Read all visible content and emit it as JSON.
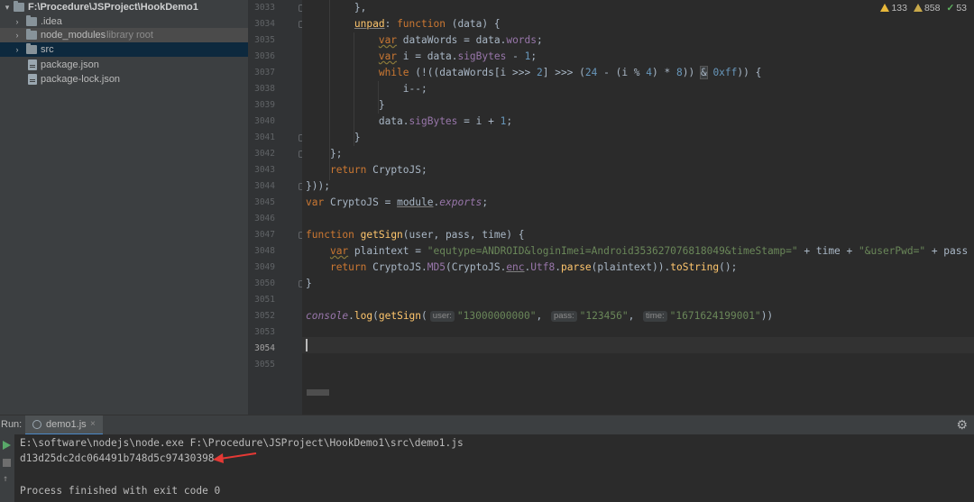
{
  "project_tree": {
    "root": "F:\\Procedure\\JSProject\\HookDemo1",
    "items": [
      {
        "label": "F:\\Procedure\\JSProject\\HookDemo1",
        "type": "folder",
        "expanded": true,
        "depth": 0
      },
      {
        "label": ".idea",
        "type": "folder",
        "expanded": false,
        "depth": 1
      },
      {
        "label": "node_modules",
        "sub": "library root",
        "type": "folder",
        "expanded": false,
        "depth": 1
      },
      {
        "label": "src",
        "type": "folder",
        "expanded": false,
        "depth": 1,
        "selected": true
      },
      {
        "label": "package.json",
        "type": "file",
        "depth": 1
      },
      {
        "label": "package-lock.json",
        "type": "file",
        "depth": 1
      }
    ]
  },
  "inspections": {
    "warnings": "133",
    "weak_warnings": "858",
    "ok": "53"
  },
  "editor": {
    "line_numbers": [
      "3033",
      "3034",
      "3035",
      "3036",
      "3037",
      "3038",
      "3039",
      "3040",
      "3041",
      "3042",
      "3043",
      "3044",
      "3045",
      "3046",
      "3047",
      "3048",
      "3049",
      "3050",
      "3051",
      "3052",
      "3053",
      "3054",
      "3055"
    ],
    "current_line": "3054",
    "lines": {
      "l3033": "},",
      "l3034_name": "unpad",
      "l3034_rest": "(data) {",
      "l3035_var": "dataWords",
      "l3035_obj": "data.",
      "l3035_prop": "words",
      "l3036_var": "i",
      "l3036_obj": "data.",
      "l3036_prop": "sigBytes",
      "l3036_num": "1",
      "l3037_a": "(!((dataWords[i >>> ",
      "l3037_n1": "2",
      "l3037_b": "] >>> (",
      "l3037_n2": "24",
      "l3037_c": " - (i % ",
      "l3037_n3": "4",
      "l3037_d": ") * ",
      "l3037_n4": "8",
      "l3037_e": ")) ",
      "l3037_amp": "&",
      "l3037_hex": "0xff",
      "l3037_f": ")) {",
      "l3038": "i--;",
      "l3039": "}",
      "l3040_obj": "data.",
      "l3040_prop": "sigBytes",
      "l3040_rest": " = i + ",
      "l3040_num": "1",
      "l3041": "}",
      "l3042": "};",
      "l3043_ret": "return",
      "l3043_rest": " CryptoJS;",
      "l3044": "}));",
      "l3045_name": "CryptoJS",
      "l3045_mod": "module",
      "l3045_exp": "exports",
      "l3047_func": "function",
      "l3047_name": "getSign",
      "l3047_rest": "(user, pass, time) {",
      "l3048_var": "plaintext",
      "l3048_str1": "\"equtype=ANDROID&loginImei=Android353627076818049&timeStamp=\"",
      "l3048_mid1": " + time + ",
      "l3048_str2": "\"&userPwd=\"",
      "l3048_mid2": " + pass + ",
      "l3048_str3": "\"&",
      "l3049_ret": "return",
      "l3049_a": " CryptoJS.",
      "l3049_md5": "MD5",
      "l3049_b": "(CryptoJS.",
      "l3049_enc": "enc",
      "l3049_c": ".",
      "l3049_utf": "Utf8",
      "l3049_d": ".",
      "l3049_parse": "parse",
      "l3049_e": "(plaintext)).",
      "l3049_ts": "toString",
      "l3049_f": "();",
      "l3050": "}",
      "l3052_console": "console",
      "l3052_log": "log",
      "l3052_getsign": "getSign",
      "l3052_h1": "user:",
      "l3052_v1": "\"13000000000\"",
      "l3052_h2": "pass:",
      "l3052_v2": "\"123456\"",
      "l3052_h3": "time:",
      "l3052_v3": "\"1671624199001\"",
      "l3052_end": "))"
    },
    "keywords": {
      "function": "function",
      "var": "var",
      "while": "while"
    }
  },
  "run_panel": {
    "label": "Run:",
    "tab": "demo1.js",
    "close": "×",
    "settings_icon": "⚙",
    "console": {
      "command": "E:\\software\\nodejs\\node.exe F:\\Procedure\\JSProject\\HookDemo1\\src\\demo1.js",
      "output": "d13d25dc2dc064491b748d5c97430398",
      "exit": "Process finished with exit code 0"
    }
  },
  "colors": {
    "keyword": "#cc7832",
    "function": "#ffc66d",
    "string": "#6a8759",
    "number": "#6897bb",
    "property": "#9876aa",
    "arrow": "#e53935"
  }
}
